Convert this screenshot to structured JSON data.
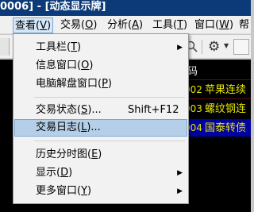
{
  "window": {
    "title": "0006] - [动态显示牌]"
  },
  "menubar": {
    "items": [
      {
        "label": "查看(",
        "key": "V",
        "suffix": ")"
      },
      {
        "label": "交易(",
        "key": "O",
        "suffix": ")"
      },
      {
        "label": "分析(",
        "key": "A",
        "suffix": ")"
      },
      {
        "label": "工具(",
        "key": "T",
        "suffix": ")"
      },
      {
        "label": "窗口(",
        "key": "W",
        "suffix": ")"
      },
      {
        "label": "帮"
      }
    ]
  },
  "toolbar": {
    "icons": [
      "search-icon",
      "gear-icon",
      "dropdown-arrow-icon"
    ]
  },
  "grid": {
    "header": "码",
    "rows": [
      {
        "code": "002",
        "name": "苹果连续"
      },
      {
        "code": "003",
        "name": "螺纹钢连"
      },
      {
        "code": "004",
        "name": "国泰转债"
      }
    ],
    "colors": {
      "background": "#000000",
      "text": "#e6e600",
      "selected": "#0000a0"
    }
  },
  "view_menu": {
    "items": [
      {
        "label": "工具栏(",
        "key": "T",
        "suffix": ")",
        "shortcut": "",
        "submenu": true
      },
      {
        "label": "信息窗口(",
        "key": "O",
        "suffix": ")",
        "shortcut": "",
        "submenu": false
      },
      {
        "label": "电脑解盘窗口(",
        "key": "P",
        "suffix": ")",
        "shortcut": "",
        "submenu": false
      },
      {
        "label": "交易状态(",
        "key": "S",
        "suffix": ")...",
        "shortcut": "Shift+F12",
        "submenu": false
      },
      {
        "label": "交易日志(",
        "key": "L",
        "suffix": ")...",
        "shortcut": "",
        "submenu": false,
        "highlighted": true
      },
      {
        "label": "历史分时图(",
        "key": "E",
        "suffix": ")",
        "shortcut": "",
        "submenu": false
      },
      {
        "label": "显示(",
        "key": "D",
        "suffix": ")",
        "shortcut": "",
        "submenu": true
      },
      {
        "label": "更多窗口(",
        "key": "Y",
        "suffix": ")",
        "shortcut": "",
        "submenu": true
      }
    ]
  }
}
